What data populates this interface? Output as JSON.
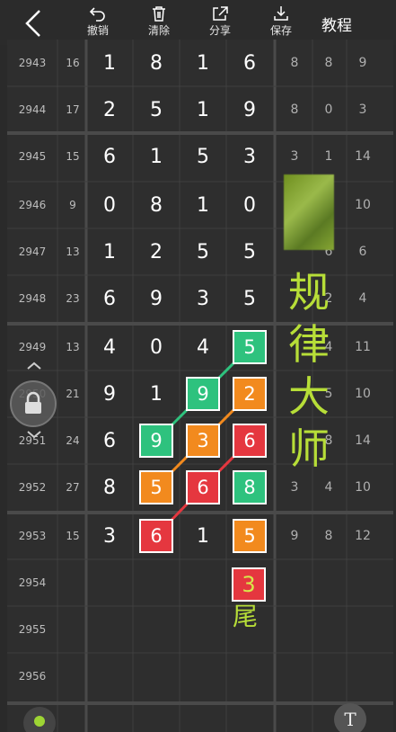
{
  "toolbar": {
    "undo_label": "撤销",
    "clear_label": "清除",
    "share_label": "分享",
    "save_label": "保存",
    "tutorial_label": "教程"
  },
  "rows": [
    {
      "issue": "2943",
      "sum": "16",
      "digits": [
        "1",
        "8",
        "1",
        "6"
      ],
      "stats": [
        "8",
        "8",
        "9"
      ]
    },
    {
      "issue": "2944",
      "sum": "17",
      "digits": [
        "2",
        "5",
        "1",
        "9"
      ],
      "stats": [
        "8",
        "0",
        "3"
      ]
    },
    {
      "issue": "2945",
      "sum": "15",
      "digits": [
        "6",
        "1",
        "5",
        "3"
      ],
      "stats": [
        "3",
        "1",
        "14"
      ]
    },
    {
      "issue": "2946",
      "sum": "9",
      "digits": [
        "0",
        "8",
        "1",
        "0"
      ],
      "stats": [
        "",
        "",
        "10"
      ]
    },
    {
      "issue": "2947",
      "sum": "13",
      "digits": [
        "1",
        "2",
        "5",
        "5"
      ],
      "stats": [
        "",
        "6",
        "6"
      ]
    },
    {
      "issue": "2948",
      "sum": "23",
      "digits": [
        "6",
        "9",
        "3",
        "5"
      ],
      "stats": [
        "",
        "2",
        "4"
      ]
    },
    {
      "issue": "2949",
      "sum": "13",
      "digits": [
        "4",
        "0",
        "4",
        "5"
      ],
      "stats": [
        "",
        "4",
        "11"
      ]
    },
    {
      "issue": "2950",
      "sum": "21",
      "digits": [
        "9",
        "1",
        "9",
        "2"
      ],
      "stats": [
        "",
        "5",
        "10"
      ]
    },
    {
      "issue": "2951",
      "sum": "24",
      "digits": [
        "6",
        "9",
        "3",
        "6"
      ],
      "stats": [
        "",
        "8",
        "14"
      ]
    },
    {
      "issue": "2952",
      "sum": "27",
      "digits": [
        "8",
        "5",
        "6",
        "8"
      ],
      "stats": [
        "3",
        "4",
        "10"
      ]
    },
    {
      "issue": "2953",
      "sum": "15",
      "digits": [
        "3",
        "6",
        "1",
        "5"
      ],
      "stats": [
        "9",
        "8",
        "12"
      ]
    },
    {
      "issue": "2954",
      "sum": "",
      "digits": [
        "",
        "",
        "",
        ""
      ],
      "stats": [
        "",
        "",
        ""
      ]
    },
    {
      "issue": "2955",
      "sum": "",
      "digits": [
        "",
        "",
        "",
        ""
      ],
      "stats": [
        "",
        "",
        ""
      ]
    },
    {
      "issue": "2956",
      "sum": "",
      "digits": [
        "",
        "",
        "",
        ""
      ],
      "stats": [
        "",
        "",
        ""
      ]
    }
  ],
  "highlights": [
    {
      "row": 6,
      "col": 3,
      "color": "green"
    },
    {
      "row": 7,
      "col": 2,
      "color": "green"
    },
    {
      "row": 7,
      "col": 3,
      "color": "orange"
    },
    {
      "row": 8,
      "col": 1,
      "color": "green"
    },
    {
      "row": 8,
      "col": 2,
      "color": "orange"
    },
    {
      "row": 8,
      "col": 3,
      "color": "red"
    },
    {
      "row": 9,
      "col": 1,
      "color": "orange"
    },
    {
      "row": 9,
      "col": 2,
      "color": "red"
    },
    {
      "row": 9,
      "col": 3,
      "color": "green"
    },
    {
      "row": 10,
      "col": 1,
      "color": "red"
    },
    {
      "row": 10,
      "col": 3,
      "color": "orange"
    }
  ],
  "overlay": {
    "watermark_text": "规律大师",
    "tail_digit": "3",
    "tail_label": "尾",
    "text_tool_label": "T"
  },
  "colors": {
    "green": "#2ec27e",
    "orange": "#f28a1e",
    "red": "#e5373f",
    "watermark": "#b7de38"
  },
  "icons": [
    "back-icon",
    "undo-icon",
    "trash-icon",
    "share-icon",
    "download-icon",
    "lock-icon",
    "chevron-up-icon",
    "chevron-down-icon"
  ]
}
